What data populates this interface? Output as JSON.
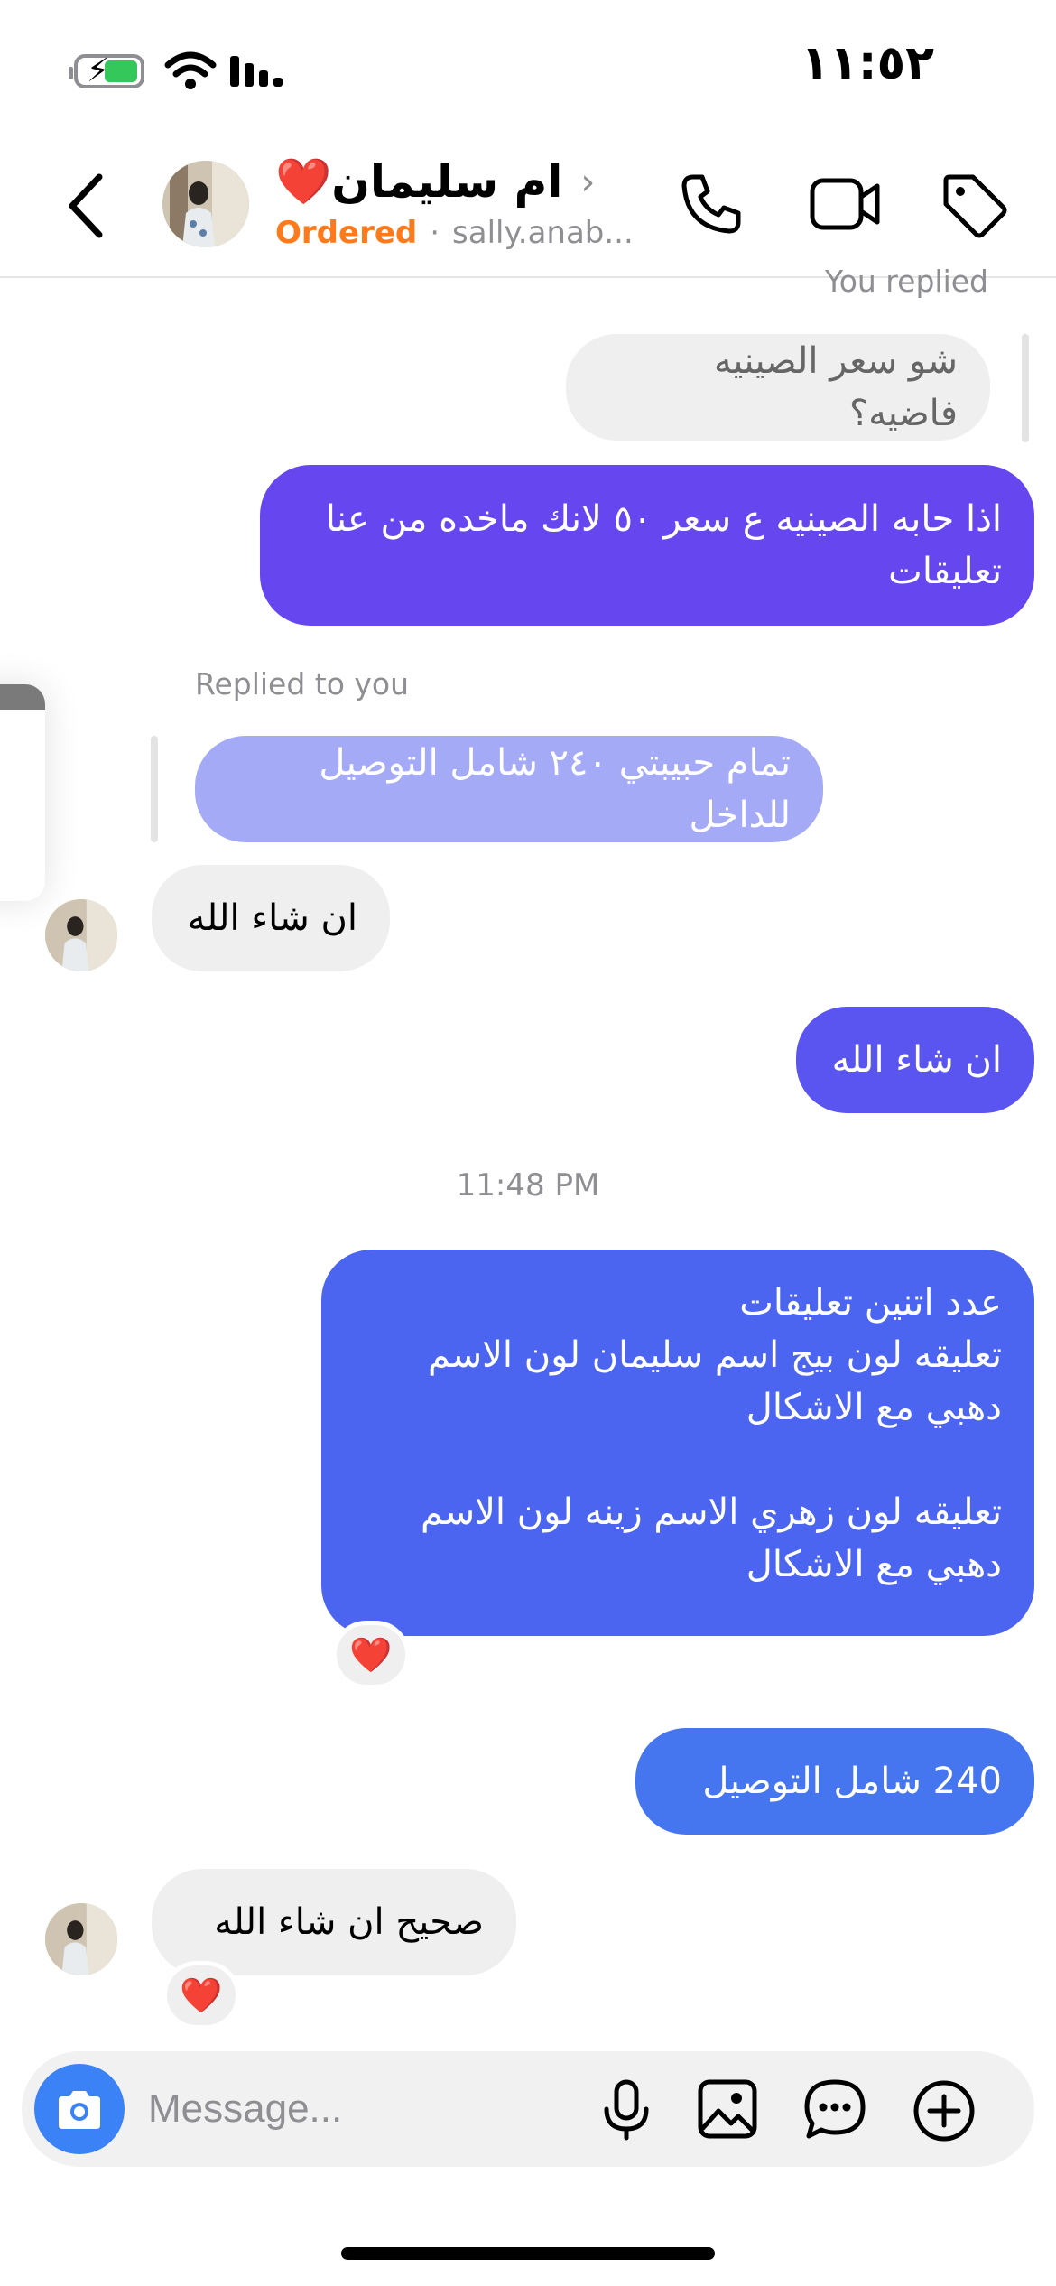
{
  "status_bar": {
    "time": "١١:٥٢"
  },
  "header": {
    "contact_name": "ام سليمان❤️",
    "order_status": "Ordered",
    "separator": "·",
    "handle": "sally.anab...",
    "icons": [
      "back-chevron-icon",
      "phone-icon",
      "video-camera-icon",
      "tag-icon"
    ]
  },
  "messages": {
    "you_replied_label": "You replied",
    "m1_text": "شو سعر الصينيه فاضيه؟",
    "m2_text": "اذا حابه الصينيه ع سعر ٥٠ لانك ماخده من عنا تعليقات",
    "replied_to_you_label": "Replied to you",
    "m3_quote": "تمام حبيبتي ٢٤٠ شامل التوصيل للداخل",
    "m4_text": "ان شاء الله",
    "m5_text": "ان شاء الله",
    "timestamp": "11:48 PM",
    "m6_text": "عدد اتنين تعليقات\nتعليقه لون بيج اسم سليمان لون الاسم دهبي مع الاشكال\n\nتعليقه لون زهري الاسم زينه لون الاسم دهبي مع الاشكال",
    "m6_reaction": "❤️",
    "m7_text": "240 شامل التوصيل",
    "m8_text": "صحيح ان شاء الله",
    "m8_reaction": "❤️"
  },
  "composer": {
    "placeholder": "Message...",
    "icons": [
      "camera-icon",
      "microphone-icon",
      "image-icon",
      "chat-bubble-icon",
      "plus-circle-icon"
    ]
  },
  "colors": {
    "accent_blue": "#3b82f6",
    "ordered_orange": "#ff7a1a",
    "bubble_purple": "#6646ee",
    "bubble_blue": "#4576ef"
  }
}
